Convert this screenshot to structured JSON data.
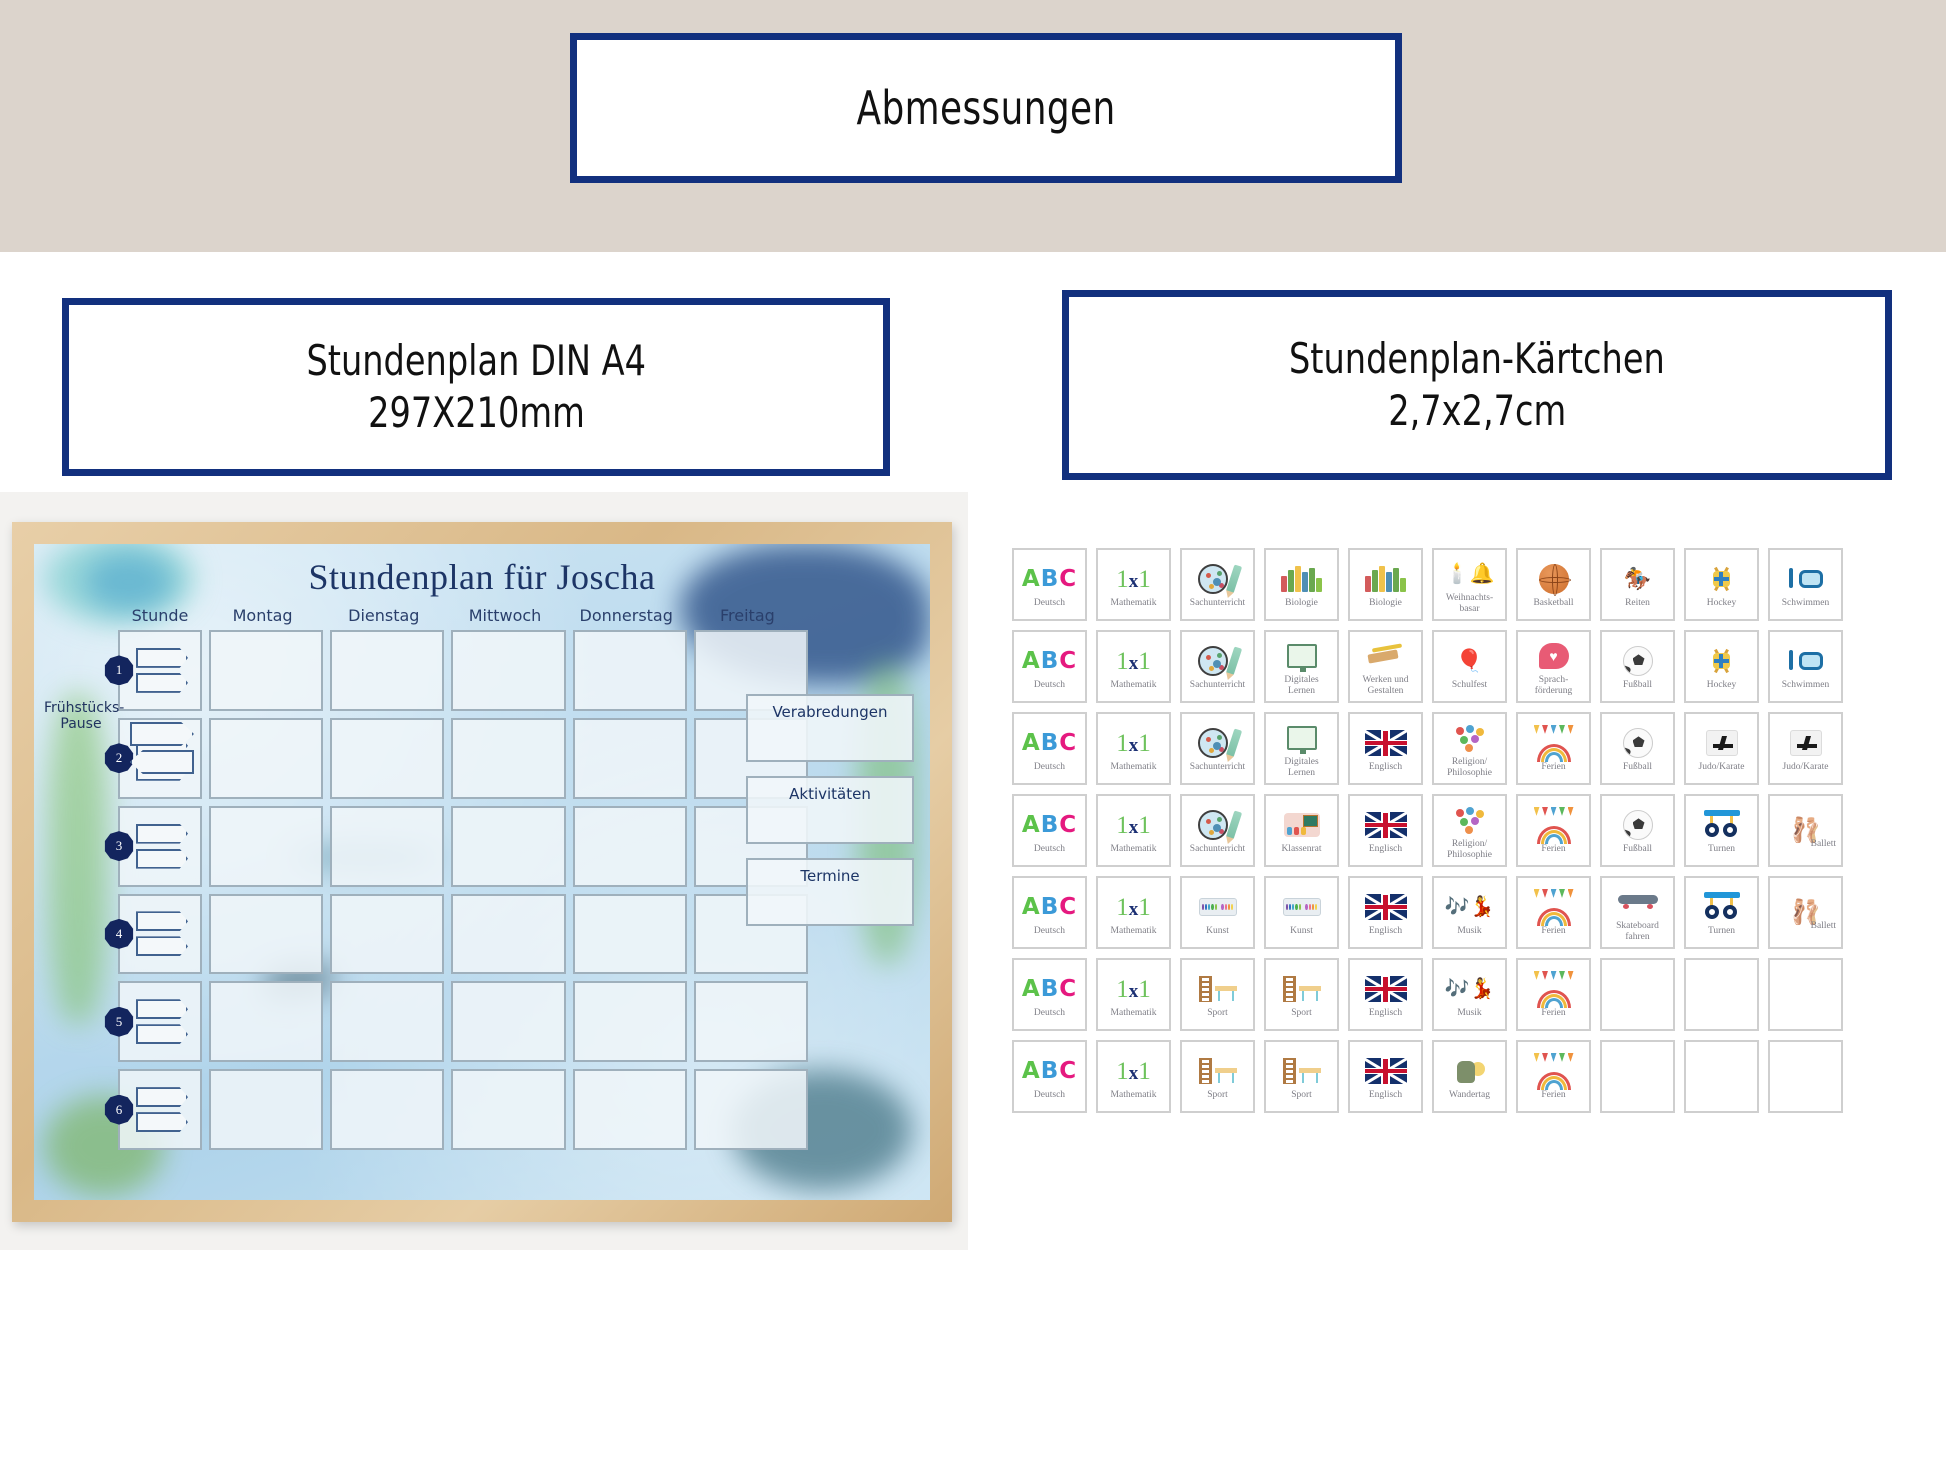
{
  "header": {
    "title": "Abmessungen",
    "band_color": "#dcd4cc",
    "border_color": "#12307e"
  },
  "sub_boxes": [
    {
      "line1": "Stundenplan DIN A4",
      "line2": "297X210mm"
    },
    {
      "line1": "Stundenplan-Kärtchen",
      "line2": "2,7x2,7cm"
    }
  ],
  "poster": {
    "title": "Stundenplan für Joscha",
    "columns": [
      "Stunde",
      "Montag",
      "Dienstag",
      "Mittwoch",
      "Donnerstag",
      "Freitag"
    ],
    "hours": [
      "1",
      "2",
      "3",
      "4",
      "5",
      "6"
    ],
    "break_label": "Frühstücks-\nPause",
    "side_boxes": [
      "Verabredungen",
      "Aktivitäten",
      "Termine"
    ]
  },
  "cards": [
    {
      "label": "Deutsch",
      "icon": "abc-icon"
    },
    {
      "label": "Mathematik",
      "icon": "times-table-icon"
    },
    {
      "label": "Sachunterricht",
      "icon": "petri-dish-pencil-icon"
    },
    {
      "label": "Biologie",
      "icon": "science-books-icon"
    },
    {
      "label": "Biologie",
      "icon": "science-books-icon"
    },
    {
      "label": "Weihnachts-\nbasar",
      "icon": "christmas-bells-icon"
    },
    {
      "label": "Basketball",
      "icon": "basketball-icon"
    },
    {
      "label": "Reiten",
      "icon": "saddle-icon"
    },
    {
      "label": "Hockey",
      "icon": "hockey-sticks-icon"
    },
    {
      "label": "Schwimmen",
      "icon": "swim-goggles-icon"
    },
    {
      "label": "Deutsch",
      "icon": "abc-icon"
    },
    {
      "label": "Mathematik",
      "icon": "times-table-icon"
    },
    {
      "label": "Sachunterricht",
      "icon": "petri-dish-pencil-icon"
    },
    {
      "label": "Digitales\nLernen",
      "icon": "computer-monitor-icon"
    },
    {
      "label": "Werken und\nGestalten",
      "icon": "saw-wood-icon"
    },
    {
      "label": "Schulfest",
      "icon": "children-balloons-icon"
    },
    {
      "label": "Sprach-\nförderung",
      "icon": "speech-heart-icon"
    },
    {
      "label": "Fußball",
      "icon": "soccer-ball-icon"
    },
    {
      "label": "Hockey",
      "icon": "hockey-sticks-icon"
    },
    {
      "label": "Schwimmen",
      "icon": "swim-goggles-icon"
    },
    {
      "label": "Deutsch",
      "icon": "abc-icon"
    },
    {
      "label": "Mathematik",
      "icon": "times-table-icon"
    },
    {
      "label": "Sachunterricht",
      "icon": "petri-dish-pencil-icon"
    },
    {
      "label": "Digitales\nLernen",
      "icon": "computer-monitor-icon"
    },
    {
      "label": "Englisch",
      "icon": "uk-flag-icon"
    },
    {
      "label": "Religion/\nPhilosophie",
      "icon": "religion-symbols-icon"
    },
    {
      "label": "Ferien",
      "icon": "rainbow-bunting-icon"
    },
    {
      "label": "Fußball",
      "icon": "soccer-ball-icon"
    },
    {
      "label": "Judo/Karate",
      "icon": "judo-gi-icon"
    },
    {
      "label": "Judo/Karate",
      "icon": "judo-gi-icon"
    },
    {
      "label": "Deutsch",
      "icon": "abc-icon"
    },
    {
      "label": "Mathematik",
      "icon": "times-table-icon"
    },
    {
      "label": "Sachunterricht",
      "icon": "petri-dish-pencil-icon"
    },
    {
      "label": "Klassenrat",
      "icon": "classroom-icon"
    },
    {
      "label": "Englisch",
      "icon": "uk-flag-icon"
    },
    {
      "label": "Religion/\nPhilosophie",
      "icon": "religion-symbols-icon"
    },
    {
      "label": "Ferien",
      "icon": "rainbow-bunting-icon"
    },
    {
      "label": "Fußball",
      "icon": "soccer-ball-icon"
    },
    {
      "label": "Turnen",
      "icon": "gym-rings-icon"
    },
    {
      "label": "Ballett",
      "icon": "ballet-shoes-icon",
      "cap_side": true
    },
    {
      "label": "Deutsch",
      "icon": "abc-icon"
    },
    {
      "label": "Mathematik",
      "icon": "times-table-icon"
    },
    {
      "label": "Kunst",
      "icon": "paint-palette-icon"
    },
    {
      "label": "Kunst",
      "icon": "paint-palette-icon"
    },
    {
      "label": "Englisch",
      "icon": "uk-flag-icon"
    },
    {
      "label": "Musik",
      "icon": "music-dancers-icon"
    },
    {
      "label": "Ferien",
      "icon": "rainbow-bunting-icon"
    },
    {
      "label": "Skateboard\nfahren",
      "icon": "skateboard-icon"
    },
    {
      "label": "Turnen",
      "icon": "gym-rings-icon"
    },
    {
      "label": "Ballett",
      "icon": "ballet-shoes-icon",
      "cap_side": true
    },
    {
      "label": "Deutsch",
      "icon": "abc-icon"
    },
    {
      "label": "Mathematik",
      "icon": "times-table-icon"
    },
    {
      "label": "Sport",
      "icon": "gym-equipment-icon"
    },
    {
      "label": "Sport",
      "icon": "gym-equipment-icon"
    },
    {
      "label": "Englisch",
      "icon": "uk-flag-icon"
    },
    {
      "label": "Musik",
      "icon": "music-dancers-icon"
    },
    {
      "label": "Ferien",
      "icon": "rainbow-bunting-icon"
    },
    {
      "label": "",
      "icon": ""
    },
    {
      "label": "",
      "icon": ""
    },
    {
      "label": "",
      "icon": ""
    },
    {
      "label": "Deutsch",
      "icon": "abc-icon"
    },
    {
      "label": "Mathematik",
      "icon": "times-table-icon"
    },
    {
      "label": "Sport",
      "icon": "gym-equipment-icon"
    },
    {
      "label": "Sport",
      "icon": "gym-equipment-icon"
    },
    {
      "label": "Englisch",
      "icon": "uk-flag-icon"
    },
    {
      "label": "Wandertag",
      "icon": "backpack-sun-icon"
    },
    {
      "label": "Ferien",
      "icon": "rainbow-bunting-icon"
    },
    {
      "label": "",
      "icon": ""
    },
    {
      "label": "",
      "icon": ""
    },
    {
      "label": "",
      "icon": ""
    }
  ]
}
